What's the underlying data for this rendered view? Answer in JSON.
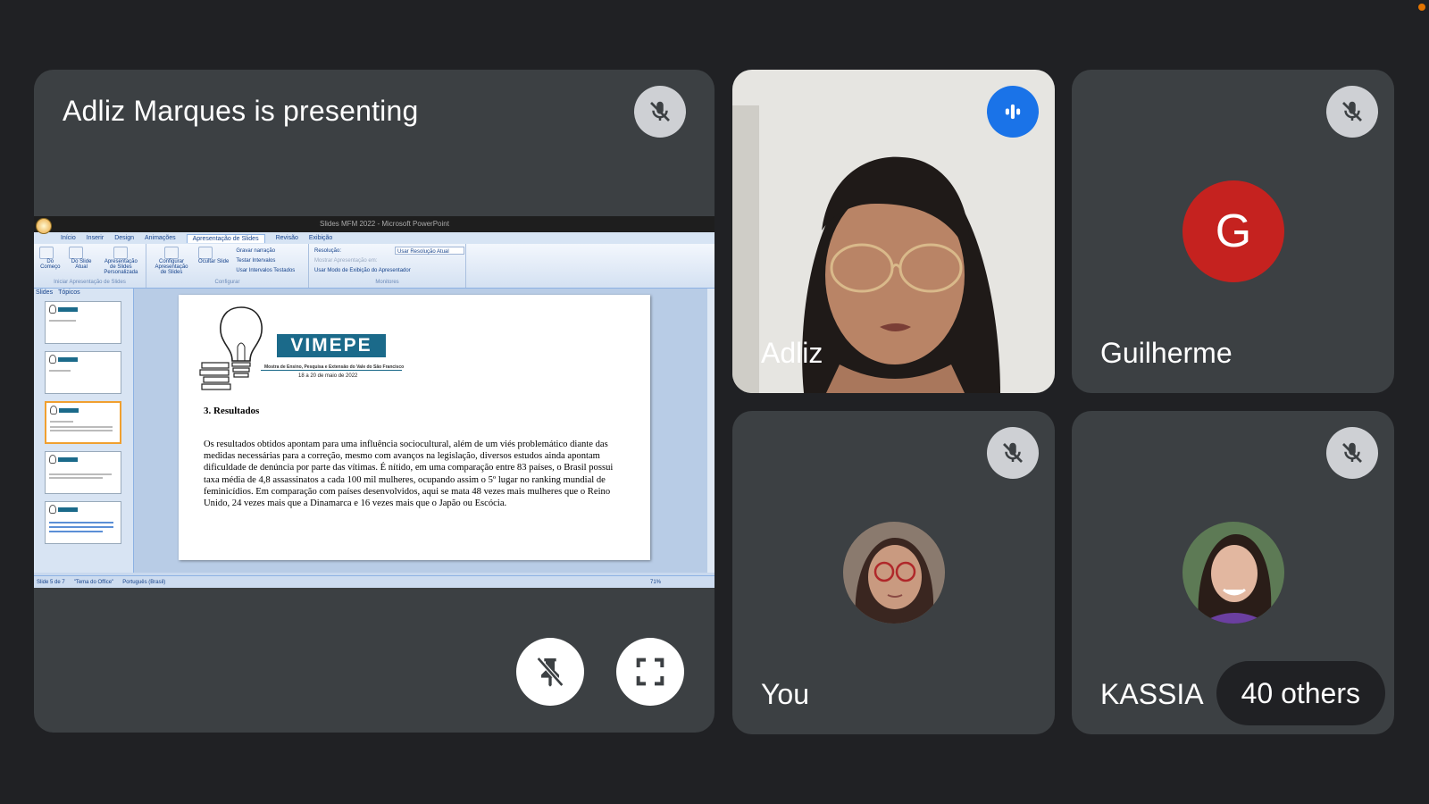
{
  "presentation": {
    "title": "Adliz Marques is presenting",
    "ppt": {
      "window_title": "Slides MFM 2022 - Microsoft PowerPoint",
      "tabs": [
        "Início",
        "Inserir",
        "Design",
        "Animações",
        "Apresentação de Slides",
        "Revisão",
        "Exibição"
      ],
      "active_tab": "Apresentação de Slides",
      "ribbon": {
        "group1_items": [
          "Do Começo",
          "Do Slide Atual",
          "Apresentação de Slides Personalizada"
        ],
        "group1_caption": "Iniciar Apresentação de Slides",
        "group2_items": [
          "Configurar Apresentação de Slides",
          "Ocultar Slide"
        ],
        "group2_checks": [
          "Gravar narração",
          "Testar Intervalos",
          "Usar Intervalos Testados"
        ],
        "group2_caption": "Configurar",
        "group3_lines": [
          "Resolução:",
          "Mostrar Apresentação em:",
          "Usar Modo de Exibição do Apresentador"
        ],
        "group3_select": "Usar Resolução Atual",
        "group3_caption": "Monitores"
      },
      "thumb_tabs": [
        "Slides",
        "Tópicos"
      ],
      "slide": {
        "logo_text": "VIMEPE",
        "logo_subtitle": "Mostra de Ensino, Pesquisa e Extensão do Vale do São Francisco",
        "logo_date": "18 a 20 de maio de 2022",
        "heading": "3. Resultados",
        "body": "Os resultados obtidos apontam para uma influência sociocultural, além de um viés problemático diante das medidas necessárias para a correção, mesmo com avanços na legislação, diversos estudos ainda apontam dificuldade de denúncia por parte das vítimas. É nítido, em uma comparação entre 83 países, o Brasil possui taxa média de 4,8 assassinatos a cada 100 mil mulheres, ocupando assim o 5º lugar no ranking mundial de feminicídios. Em comparação com países desenvolvidos, aqui se mata 48 vezes mais mulheres que o Reino Unido, 24 vezes mais que a Dinamarca e 16 vezes mais que o Japão ou Escócia."
      },
      "status": {
        "slide": "Slide 5 de 7",
        "theme": "\"Tema do Office\"",
        "language": "Português (Brasil)",
        "zoom": "71%"
      }
    }
  },
  "participants": [
    {
      "name": "Adliz",
      "state": "speaking"
    },
    {
      "name": "Guilherme",
      "state": "muted",
      "initial": "G",
      "avatar_color": "#c5221f"
    },
    {
      "name": "You",
      "state": "muted"
    },
    {
      "name": "KASSIA",
      "state": "muted"
    }
  ],
  "others": "40 others",
  "icons": {
    "mute": "mic-off-icon",
    "speaking": "audio-level-icon",
    "unpin": "unpin-icon",
    "fullscreen": "fullscreen-icon"
  }
}
